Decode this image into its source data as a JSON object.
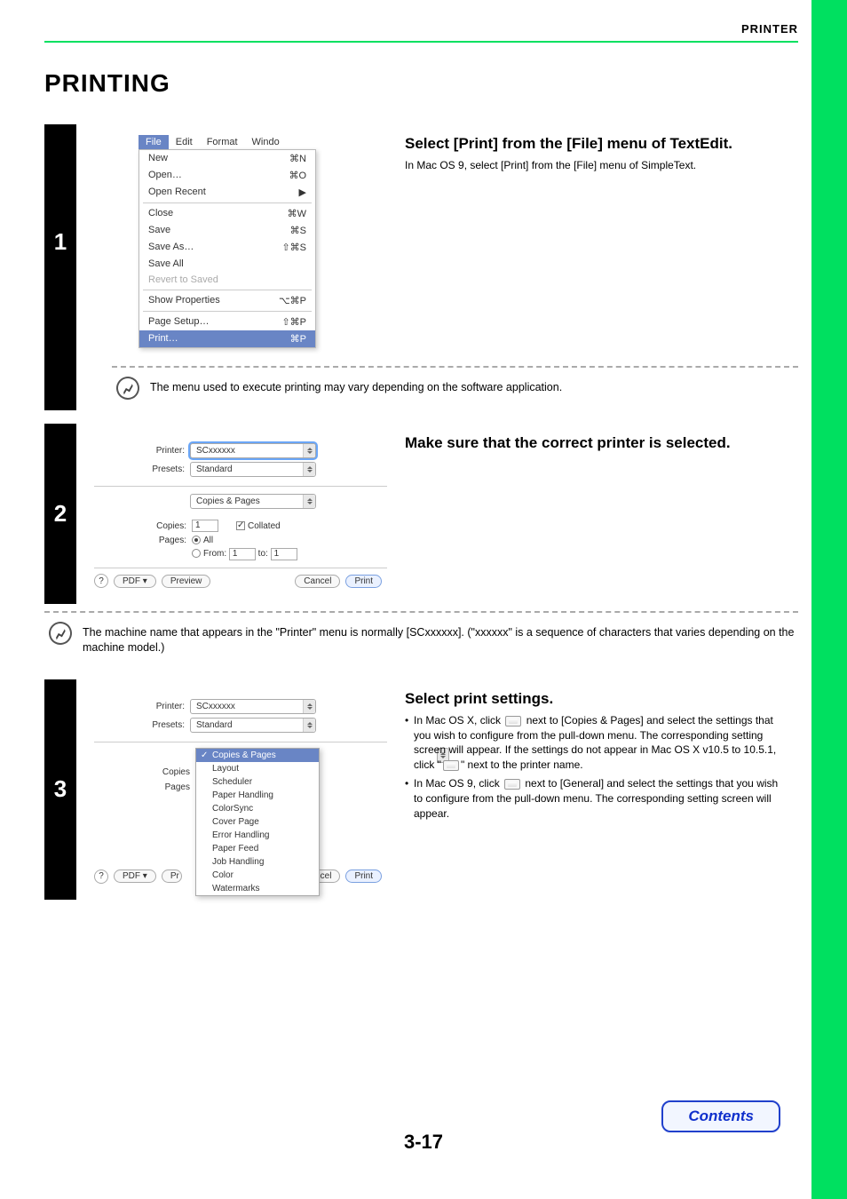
{
  "header": "PRINTER",
  "page_title": "PRINTING",
  "steps": [
    {
      "num": "1",
      "title": "Select [Print] from the [File] menu of TextEdit.",
      "desc": "In Mac OS 9, select [Print] from the [File] menu of SimpleText.",
      "note": "The menu used to execute printing may vary depending on the software application.",
      "mac_menu": {
        "header": [
          "File",
          "Edit",
          "Format",
          "Windo"
        ],
        "items": [
          {
            "label": "New",
            "key": "⌘N"
          },
          {
            "label": "Open…",
            "key": "⌘O"
          },
          {
            "label": "Open Recent",
            "key": "▶"
          },
          {
            "sep": true
          },
          {
            "label": "Close",
            "key": "⌘W"
          },
          {
            "label": "Save",
            "key": "⌘S"
          },
          {
            "label": "Save As…",
            "key": "⇧⌘S"
          },
          {
            "label": "Save All",
            "key": ""
          },
          {
            "label": "Revert to Saved",
            "key": "",
            "disabled": true
          },
          {
            "sep": true
          },
          {
            "label": "Show Properties",
            "key": "⌥⌘P"
          },
          {
            "sep": true
          },
          {
            "label": "Page Setup…",
            "key": "⇧⌘P"
          },
          {
            "label": "Print…",
            "key": "⌘P",
            "hl": true
          }
        ]
      }
    },
    {
      "num": "2",
      "title": "Make sure that the correct printer is selected.",
      "note": "The machine name that appears in the \"Printer\" menu is normally [SCxxxxxx]. (\"xxxxxx\" is a sequence of characters that varies depending on the machine model.)",
      "dialog": {
        "printer_label": "Printer:",
        "printer_value": "SCxxxxxx",
        "presets_label": "Presets:",
        "presets_value": "Standard",
        "pane_value": "Copies & Pages",
        "copies_label": "Copies:",
        "copies_value": "1",
        "collated_label": "Collated",
        "pages_label": "Pages:",
        "all_label": "All",
        "from_label": "From:",
        "from_value": "1",
        "to_label": "to:",
        "to_value": "1",
        "help": "?",
        "pdf": "PDF ▾",
        "preview": "Preview",
        "cancel": "Cancel",
        "print": "Print"
      }
    },
    {
      "num": "3",
      "title": "Select print settings.",
      "bullets": [
        {
          "pre": "In Mac OS X, click ",
          "icon": "updown",
          "post": " next to [Copies & Pages] and select the settings that you wish to configure from the pull-down menu. The corresponding setting screen will appear. If the settings do not appear in Mac OS X v10.5 to 10.5.1, click \"",
          "icon2": "down",
          "post2": "\" next to the printer name."
        },
        {
          "pre": "In Mac OS 9, click ",
          "icon": "updown",
          "post": " next to [General] and select the settings that you wish to configure from the pull-down menu. The corresponding setting screen will appear."
        }
      ],
      "dialog": {
        "printer_label": "Printer:",
        "printer_value": "SCxxxxxx",
        "presets_label": "Presets:",
        "presets_value": "Standard",
        "copies_label": "Copies",
        "pages_label": "Pages",
        "help": "?",
        "pdf": "PDF ▾",
        "preview_short": "Pr",
        "cancel": "Cancel",
        "print": "Print",
        "menu_items": [
          "Copies & Pages",
          "Layout",
          "Scheduler",
          "Paper Handling",
          "ColorSync",
          "Cover Page",
          "Error Handling",
          "Paper Feed",
          "Job Handling",
          "Color",
          "Watermarks"
        ]
      }
    }
  ],
  "page_number": "3-17",
  "contents_button": "Contents"
}
